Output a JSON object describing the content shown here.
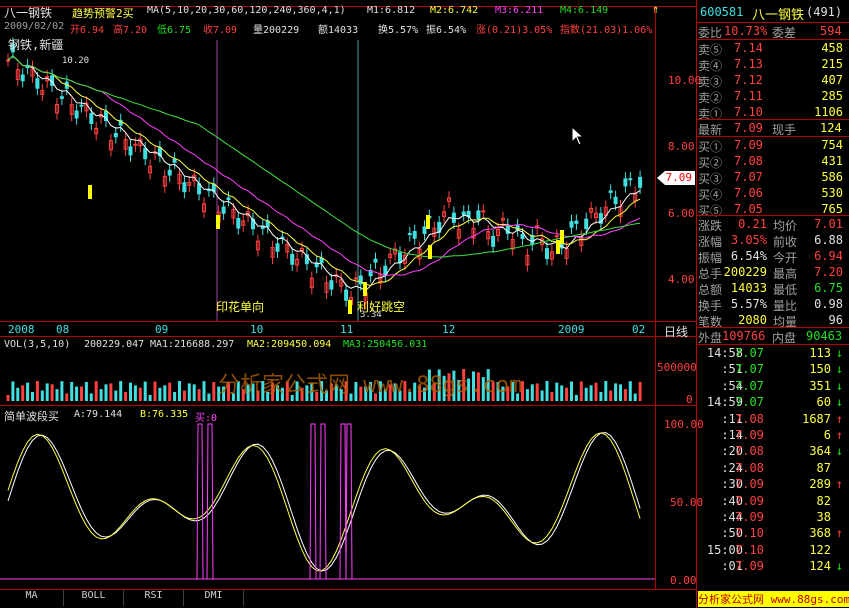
{
  "stock": {
    "name": "八一钢铁",
    "code": "600581",
    "count": "(491)"
  },
  "main_header": {
    "indicator": "趋势预警2买",
    "ma_params": "MA(5,10,20,30,60,120,240,360,4,1)",
    "m1": "M1:6.812",
    "m2": "M2:6.742",
    "m3": "M3:6.211",
    "m4": "M4:6.149",
    "date": "2009/02/02",
    "open": "开6.94",
    "high": "高7.20",
    "low": "低6.75",
    "close": "收7.09",
    "vol": "量200229",
    "amount": "额14033",
    "turnover": "换5.57%",
    "amplitude": "振6.54%",
    "change": "涨(0.21)3.05%",
    "index": "指数(21.03)1.06%",
    "sector_tag": "钢铁,新疆"
  },
  "price_axis": [
    "10.00",
    "8.00",
    "6.00",
    "4.00"
  ],
  "current_price": "7.09",
  "annotations": {
    "a1": "印花单向",
    "a2": "利好跳空",
    "low_label": "3.34",
    "high_label": "10.20"
  },
  "date_axis": [
    "2008",
    "08",
    "09",
    "10",
    "11",
    "12",
    "2009",
    "02"
  ],
  "period_label": "日线",
  "vol_header": {
    "name": "VOL(3,5,10)",
    "val": "200229.047",
    "ma1": "MA1:216688.297",
    "ma2": "MA2:209450.094",
    "ma3": "MA3:250456.031"
  },
  "vol_axis": [
    "500000",
    "0"
  ],
  "watermark": "分析家公式网 www.88gs.com",
  "osc_header": {
    "name": "简单波段买",
    "a": "A:79.144",
    "b": "B:76.335",
    "buy": "买:0"
  },
  "osc_axis": [
    "100.00",
    "50.00",
    "0.00"
  ],
  "tabs": [
    "MA",
    "BOLL",
    "RSI",
    "DMI"
  ],
  "orderbook": {
    "weibi_label": "委比",
    "weibi_val": "10.73%",
    "weicha_label": "委差",
    "weicha_val": "594",
    "asks": [
      {
        "l": "卖⑤",
        "p": "7.14",
        "v": "458"
      },
      {
        "l": "卖④",
        "p": "7.13",
        "v": "215"
      },
      {
        "l": "卖③",
        "p": "7.12",
        "v": "407"
      },
      {
        "l": "卖②",
        "p": "7.11",
        "v": "285"
      },
      {
        "l": "卖①",
        "p": "7.10",
        "v": "1106"
      }
    ],
    "last": {
      "l": "最新",
      "p": "7.09",
      "l2": "现手",
      "v": "124"
    },
    "bids": [
      {
        "l": "买①",
        "p": "7.09",
        "v": "754"
      },
      {
        "l": "买②",
        "p": "7.08",
        "v": "431"
      },
      {
        "l": "买③",
        "p": "7.07",
        "v": "586"
      },
      {
        "l": "买④",
        "p": "7.06",
        "v": "530"
      },
      {
        "l": "买⑤",
        "p": "7.05",
        "v": "765"
      }
    ],
    "stats": [
      {
        "l1": "涨跌",
        "v1": "0.21",
        "l2": "均价",
        "v2": "7.01"
      },
      {
        "l1": "涨幅",
        "v1": "3.05%",
        "l2": "前收",
        "v2": "6.88"
      },
      {
        "l1": "振幅",
        "v1": "6.54%",
        "l2": "今开",
        "v2": "6.94"
      },
      {
        "l1": "总手",
        "v1": "200229",
        "l2": "最高",
        "v2": "7.20"
      },
      {
        "l1": "总额",
        "v1": "14033",
        "l2": "最低",
        "v2": "6.75"
      },
      {
        "l1": "换手",
        "v1": "5.57%",
        "l2": "量比",
        "v2": "0.98"
      },
      {
        "l1": "笔数",
        "v1": "2080",
        "l2": "均量",
        "v2": "96"
      }
    ],
    "outer_label": "外盘",
    "outer_val": "109766",
    "inner_label": "内盘",
    "inner_val": "90463"
  },
  "ticks": [
    {
      "t": "14:58",
      "p": "7.07",
      "v": "113",
      "a": "↓"
    },
    {
      "t": ":51",
      "p": "7.07",
      "v": "150",
      "a": "↓"
    },
    {
      "t": ":54",
      "p": "7.07",
      "v": "351",
      "a": "↓"
    },
    {
      "t": "14:59",
      "p": "7.07",
      "v": "60",
      "a": "↓"
    },
    {
      "t": ":11",
      "p": "7.08",
      "v": "1687",
      "a": "↑"
    },
    {
      "t": ":14",
      "p": "7.09",
      "v": "6",
      "a": "↑"
    },
    {
      "t": ":20",
      "p": "7.08",
      "v": "364",
      "a": "↓"
    },
    {
      "t": ":24",
      "p": "7.08",
      "v": "87",
      "a": ""
    },
    {
      "t": ":30",
      "p": "7.09",
      "v": "289",
      "a": "↑"
    },
    {
      "t": ":40",
      "p": "7.09",
      "v": "82",
      "a": ""
    },
    {
      "t": ":44",
      "p": "7.09",
      "v": "38",
      "a": ""
    },
    {
      "t": ":50",
      "p": "7.10",
      "v": "368",
      "a": "↑"
    },
    {
      "t": "15:00",
      "p": "7.10",
      "v": "122",
      "a": ""
    },
    {
      "t": ":01",
      "p": "7.09",
      "v": "124",
      "a": "↓"
    }
  ],
  "footer_link": "分析家公式网 www.88gs.com"
}
